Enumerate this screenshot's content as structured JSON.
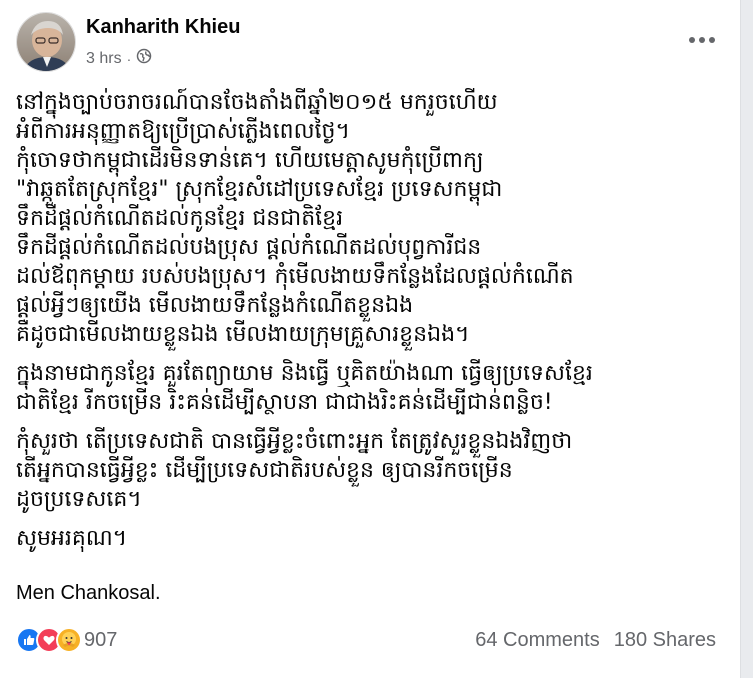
{
  "post": {
    "author": "Kanharith Khieu",
    "time": "3 hrs",
    "separator": "·",
    "audience_icon": "globe-icon",
    "more_icon": "more-icon",
    "paragraphs": [
      "នៅក្នុងច្បាប់ចរាចរណ៍បានចែងតាំងពីឆ្នាំ២០១៥ មករួចហើយ\nអំពីការអនុញ្ញាតឱ្យប្រើប្រាស់ភ្លើងពេលថ្ងៃ។\nកុំចោទថាកម្ពុជាដើរមិនទាន់គេ។ ហើយមេត្តាសូមកុំប្រើពាក្យ\n\"វាឆ្កួតតែស្រុកខ្មែរ\" ស្រុកខ្មែរសំដៅប្រទេសខ្មែរ ប្រទេសកម្ពុជា\nទឹកដីផ្ដល់កំណើតដល់កូនខ្មែរ ជនជាតិខ្មែរ\nទឹកដីផ្ដល់កំណើតដល់បងប្រុស ផ្ដល់កំណើតដល់បុព្វការីជន\nដល់ឪពុកម្ដាយ របស់បងប្រុស។ កុំមើលងាយទឹកន្លែងដែលផ្ដល់កំណើត\nផ្ដល់អ្វីៗឲ្យយើង មើលងាយទឹកន្លែងកំណើតខ្លួនឯង\nគឺដូចជាមើលងាយខ្លួនឯង មើលងាយក្រុមគ្រួសារខ្លួនឯង។",
      "ក្នុងនាមជាកូនខ្មែរ គួរតែព្យាយាម និងធ្វើ ឬគិតយ៉ាងណា ធ្វើឲ្យប្រទេសខ្មែរ\nជាតិខ្មែរ រីកចម្រើន រិះគន់ដើម្បីស្ថាបនា ជាជាងរិះគន់ដើម្បីជាន់ពន្លិច!",
      "កុំសួរថា តើប្រទេសជាតិ បានធ្វើអ្វីខ្លះចំពោះអ្នក តែត្រូវសួរខ្លួនឯងវិញថា\nតើអ្នកបានធ្វើអ្វីខ្លះ ដើម្បីប្រទេសជាតិរបស់ខ្លួន ឲ្យបានរីកចម្រើន\nដូចប្រទេសគេ។",
      "សូមអរគុណ។"
    ],
    "signature": "Men Chankosal."
  },
  "footer": {
    "reaction_count": "907",
    "reaction_icons": [
      "like-icon",
      "love-icon",
      "care-icon"
    ],
    "comments": "64 Comments",
    "shares": "180 Shares"
  },
  "colors": {
    "like": "#1877f2",
    "love": "#f33e58",
    "care": "#f7b125",
    "secondary_text": "#65676b"
  }
}
